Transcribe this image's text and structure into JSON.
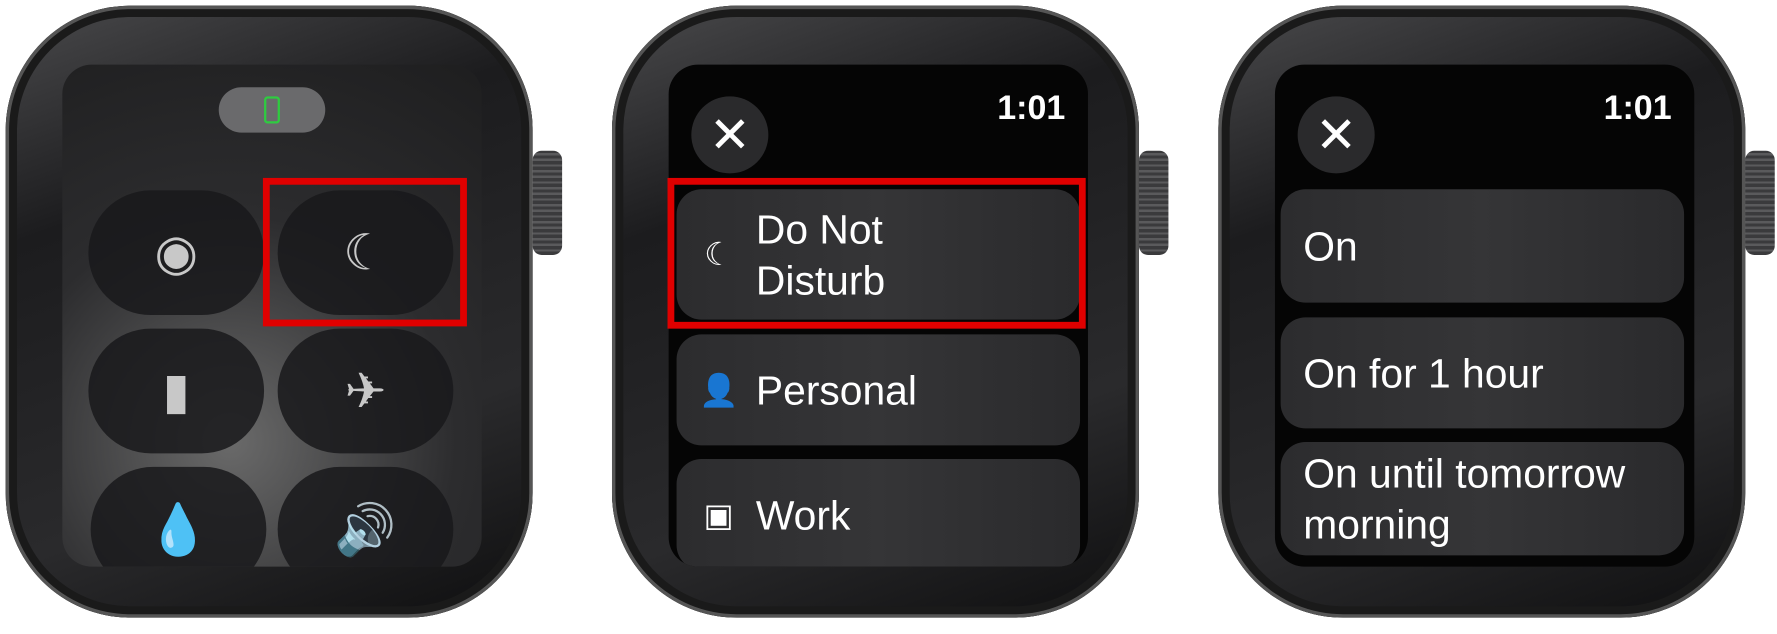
{
  "colors": {
    "highlight": "#e00000",
    "cellular": "#2ecc40"
  },
  "watch1": {
    "icons": [
      "cellular-phone-icon",
      "walkie-talkie-icon",
      "moon-icon",
      "flashlight-icon",
      "airplane-icon",
      "water-lock-icon",
      "speaker-icon"
    ],
    "glyphs": {
      "moon": "☾",
      "flashlight": "▮",
      "airplane": "✈",
      "water": "💧",
      "speaker": "🔊",
      "walkie": "◉"
    }
  },
  "watch2": {
    "time": "1:01",
    "close": "✕",
    "items": [
      {
        "label": "Do Not Disturb",
        "icon": "☾"
      },
      {
        "label": "Personal",
        "icon": "👤"
      },
      {
        "label": "Work",
        "icon": "▣"
      }
    ]
  },
  "watch3": {
    "time": "1:01",
    "close": "✕",
    "items": [
      {
        "label": "On"
      },
      {
        "label": "On for 1 hour"
      },
      {
        "label": "On until tomorrow morning"
      }
    ]
  }
}
